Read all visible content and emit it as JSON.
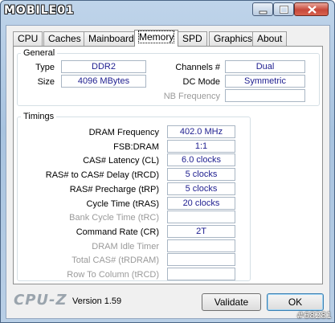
{
  "app": {
    "logo_text": "MOBILE01",
    "brand": "CPU-Z",
    "version": "Version 1.59",
    "watermark": "#68281"
  },
  "tabs": [
    "CPU",
    "Caches",
    "Mainboard",
    "Memory",
    "SPD",
    "Graphics",
    "About"
  ],
  "active_tab": "Memory",
  "general": {
    "title": "General",
    "type_label": "Type",
    "type_value": "DDR2",
    "size_label": "Size",
    "size_value": "4096 MBytes",
    "channels_label": "Channels #",
    "channels_value": "Dual",
    "dc_mode_label": "DC Mode",
    "dc_mode_value": "Symmetric",
    "nb_freq_label": "NB Frequency",
    "nb_freq_value": ""
  },
  "timings": {
    "title": "Timings",
    "rows": [
      {
        "label": "DRAM Frequency",
        "value": "402.0 MHz",
        "enabled": true
      },
      {
        "label": "FSB:DRAM",
        "value": "1:1",
        "enabled": true
      },
      {
        "label": "CAS# Latency (CL)",
        "value": "6.0 clocks",
        "enabled": true
      },
      {
        "label": "RAS# to CAS# Delay (tRCD)",
        "value": "5 clocks",
        "enabled": true
      },
      {
        "label": "RAS# Precharge (tRP)",
        "value": "5 clocks",
        "enabled": true
      },
      {
        "label": "Cycle Time (tRAS)",
        "value": "20 clocks",
        "enabled": true
      },
      {
        "label": "Bank Cycle Time (tRC)",
        "value": "",
        "enabled": false
      },
      {
        "label": "Command Rate (CR)",
        "value": "2T",
        "enabled": true
      },
      {
        "label": "DRAM Idle Timer",
        "value": "",
        "enabled": false
      },
      {
        "label": "Total CAS# (tRDRAM)",
        "value": "",
        "enabled": false
      },
      {
        "label": "Row To Column (tRCD)",
        "value": "",
        "enabled": false
      }
    ]
  },
  "buttons": {
    "validate": "Validate",
    "ok": "OK"
  }
}
